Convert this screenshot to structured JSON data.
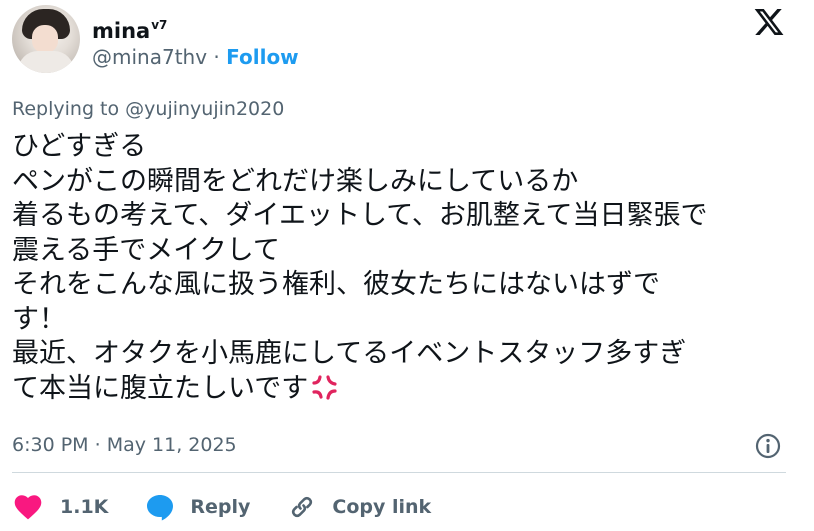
{
  "author": {
    "display_name": "mina",
    "name_suffix": "v7",
    "handle": "@mina7thv",
    "separator": "·",
    "follow_label": "Follow"
  },
  "reply_to": {
    "prefix": "Replying to",
    "handle": "@yujinyujin2020"
  },
  "tweet": {
    "lines": [
      "ひどすぎる",
      "ペンがこの瞬間をどれだけ楽しみにしているか",
      "着るもの考えて、ダイエットして、お肌整えて当日緊張で",
      "震える手でメイクして",
      "それをこんな風に扱う権利、彼女たちにはないはずで",
      "す！",
      "最近、オタクを小馬鹿にしてるイベントスタッフ多すぎ",
      "て本当に腹立たしいです"
    ],
    "trailing_emoji_icon": "anger-symbol"
  },
  "meta": {
    "time": "6:30 PM",
    "separator": "·",
    "date": "May 11, 2025"
  },
  "actions": {
    "likes_count": "1.1K",
    "reply_label": "Reply",
    "copy_link_label": "Copy link"
  },
  "colors": {
    "accent_blue": "#1d9bf0",
    "heart_red": "#f91880",
    "reply_blue": "#1d9bf0",
    "muted_text": "#536471",
    "anger_red": "#e0245e"
  },
  "icons": [
    "x-logo-icon",
    "info-icon",
    "heart-icon",
    "reply-bubble-icon",
    "link-icon",
    "anger-symbol-icon"
  ]
}
